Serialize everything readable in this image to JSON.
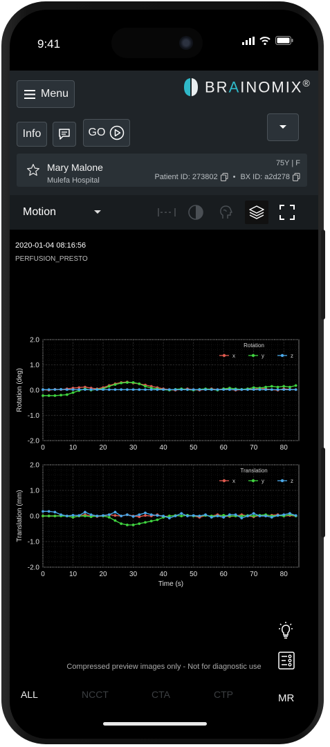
{
  "status": {
    "time": "9:41"
  },
  "toolbar": {
    "menu_label": "Menu",
    "info_label": "Info",
    "go_label": "GO"
  },
  "brand": {
    "name_pre": "BR",
    "name_accent": "A",
    "name_post": "INOMIX",
    "reg": "®"
  },
  "patient": {
    "name": "Mary Malone",
    "hospital": "Mulefa Hospital",
    "age_sex": "75Y | F",
    "patient_id": "Patient ID: 273802",
    "separator": "•",
    "bx_id": "BX ID: a2d278"
  },
  "viewer": {
    "mode_label": "Motion"
  },
  "study": {
    "datetime": "2020-01-04 08:16:56",
    "sequence": "PERFUSION_PRESTO"
  },
  "chart_data": [
    {
      "type": "line",
      "title": "Rotation",
      "ylabel": "Rotation (deg)",
      "xlabel": "",
      "ylim": [
        -2.0,
        2.0
      ],
      "xlim": [
        0,
        85
      ],
      "xticks": [
        "0",
        "10",
        "20",
        "30",
        "40",
        "50",
        "60",
        "70",
        "80"
      ],
      "yticks": [
        "2.0",
        "1.0",
        "0.0",
        "-1.0",
        "-2.0"
      ],
      "legend": "top-right",
      "grid": true,
      "x": [
        0,
        2,
        4,
        6,
        8,
        10,
        12,
        14,
        16,
        18,
        20,
        22,
        24,
        26,
        28,
        30,
        32,
        34,
        36,
        38,
        40,
        42,
        44,
        46,
        48,
        50,
        52,
        54,
        56,
        58,
        60,
        62,
        64,
        66,
        68,
        70,
        72,
        74,
        76,
        78,
        80,
        82,
        84
      ],
      "series": [
        {
          "name": "x",
          "color": "#e05a4f",
          "values": [
            0.02,
            0.0,
            0.03,
            0.02,
            0.05,
            0.08,
            0.1,
            0.12,
            0.08,
            0.05,
            0.1,
            0.18,
            0.25,
            0.3,
            0.32,
            0.28,
            0.25,
            0.2,
            0.15,
            0.1,
            0.05,
            0.02,
            0.0,
            0.03,
            0.05,
            0.02,
            0.0,
            0.03,
            0.05,
            0.02,
            0.05,
            0.03,
            0.0,
            0.02,
            0.05,
            0.03,
            0.08,
            0.05,
            0.02,
            0.0,
            0.05,
            0.03,
            0.02
          ]
        },
        {
          "name": "y",
          "color": "#3fd23f",
          "values": [
            -0.22,
            -0.22,
            -0.22,
            -0.2,
            -0.18,
            -0.1,
            -0.02,
            0.05,
            0.0,
            0.03,
            0.05,
            0.15,
            0.22,
            0.28,
            0.3,
            0.3,
            0.25,
            0.15,
            0.08,
            0.05,
            0.02,
            0.0,
            0.03,
            0.05,
            0.02,
            0.0,
            0.03,
            0.05,
            0.03,
            0.0,
            0.05,
            0.08,
            0.05,
            0.03,
            0.05,
            0.1,
            0.08,
            0.12,
            0.15,
            0.12,
            0.15,
            0.12,
            0.18
          ]
        },
        {
          "name": "z",
          "color": "#4aa8e8",
          "values": [
            0.02,
            0.02,
            0.02,
            0.03,
            0.02,
            0.02,
            0.02,
            0.02,
            0.02,
            0.02,
            0.02,
            0.02,
            0.02,
            0.02,
            0.02,
            0.02,
            0.02,
            0.02,
            0.02,
            0.02,
            0.02,
            0.02,
            0.02,
            0.02,
            0.02,
            0.02,
            0.02,
            0.02,
            0.02,
            0.02,
            0.02,
            0.02,
            0.02,
            0.02,
            0.02,
            0.02,
            0.02,
            0.02,
            0.02,
            0.02,
            0.02,
            0.02,
            0.02
          ]
        }
      ]
    },
    {
      "type": "line",
      "title": "Translation",
      "ylabel": "Translation (mm)",
      "xlabel": "Time (s)",
      "ylim": [
        -2.0,
        2.0
      ],
      "xlim": [
        0,
        85
      ],
      "xticks": [
        "0",
        "10",
        "20",
        "30",
        "40",
        "50",
        "60",
        "70",
        "80"
      ],
      "yticks": [
        "2.0",
        "1.0",
        "0.0",
        "-1.0",
        "-2.0"
      ],
      "legend": "top-right",
      "grid": true,
      "x": [
        0,
        2,
        4,
        6,
        8,
        10,
        12,
        14,
        16,
        18,
        20,
        22,
        24,
        26,
        28,
        30,
        32,
        34,
        36,
        38,
        40,
        42,
        44,
        46,
        48,
        50,
        52,
        54,
        56,
        58,
        60,
        62,
        64,
        66,
        68,
        70,
        72,
        74,
        76,
        78,
        80,
        82,
        84
      ],
      "series": [
        {
          "name": "x",
          "color": "#e05a4f",
          "values": [
            0.0,
            0.0,
            0.0,
            0.02,
            0.0,
            -0.05,
            0.0,
            0.05,
            0.0,
            -0.02,
            0.0,
            0.05,
            0.02,
            0.0,
            0.05,
            0.0,
            -0.03,
            0.02,
            0.0,
            0.05,
            -0.03,
            0.0,
            0.02,
            0.0,
            0.03,
            0.0,
            -0.05,
            0.02,
            0.0,
            0.05,
            0.0,
            -0.02,
            0.0,
            0.05,
            0.0,
            -0.03,
            0.02,
            0.0,
            0.03,
            0.05,
            0.0,
            0.02,
            0.0
          ]
        },
        {
          "name": "y",
          "color": "#3fd23f",
          "values": [
            0.0,
            0.0,
            0.0,
            0.0,
            0.0,
            -0.05,
            0.0,
            0.0,
            -0.03,
            0.0,
            0.0,
            -0.05,
            -0.18,
            -0.3,
            -0.35,
            -0.35,
            -0.3,
            -0.25,
            -0.2,
            -0.15,
            -0.05,
            0.0,
            0.02,
            0.0,
            0.03,
            0.0,
            0.0,
            0.02,
            0.0,
            0.0,
            0.03,
            0.0,
            0.0,
            0.0,
            0.02,
            0.0,
            0.03,
            0.05,
            0.0,
            0.02,
            0.0,
            0.05,
            0.0
          ]
        },
        {
          "name": "z",
          "color": "#4aa8e8",
          "values": [
            0.18,
            0.18,
            0.15,
            0.05,
            0.0,
            0.03,
            0.02,
            0.15,
            0.05,
            0.0,
            0.02,
            0.05,
            0.15,
            0.0,
            0.05,
            -0.02,
            0.05,
            0.12,
            0.05,
            0.02,
            0.0,
            -0.08,
            0.0,
            0.1,
            0.0,
            0.02,
            0.0,
            0.05,
            -0.05,
            0.0,
            -0.05,
            0.05,
            0.05,
            -0.08,
            0.0,
            0.1,
            0.0,
            0.0,
            -0.05,
            0.02,
            0.05,
            0.1,
            0.02
          ]
        }
      ]
    }
  ],
  "footer": {
    "disclaimer": "Compressed preview images only - Not for diagnostic use"
  },
  "tabs": {
    "all": "ALL",
    "ncct": "NCCT",
    "cta": "CTA",
    "ctp": "CTP",
    "mr": "MR"
  }
}
